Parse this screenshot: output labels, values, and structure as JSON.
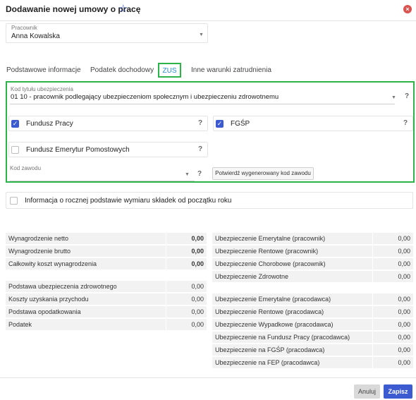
{
  "dialog": {
    "title": "Dodawanie nowej umowy o pracę",
    "cancel_label": "Anuluj",
    "save_label": "Zapisz"
  },
  "employee": {
    "label": "Pracownik",
    "value": "Anna Kowalska"
  },
  "tabs": [
    {
      "label": "Podstawowe informacje",
      "active": false
    },
    {
      "label": "Podatek dochodowy",
      "active": false
    },
    {
      "label": "ZUS",
      "active": true
    },
    {
      "label": "Inne warunki zatrudnienia",
      "active": false
    }
  ],
  "zus": {
    "insurance_code_label": "Kod tytułu ubezpieczenia",
    "insurance_code_value": "01 10 - pracownik podlegający ubezpieczeniom społecznym i ubezpieczeniu zdrowotnemu",
    "help": "?",
    "fundusz_pracy": {
      "label": "Fundusz Pracy",
      "checked": true
    },
    "fgsp": {
      "label": "FGŚP",
      "checked": true
    },
    "fep": {
      "label": "Fundusz Emerytur Pomostowych",
      "checked": false
    },
    "profession_code_label": "Kod zawodu",
    "profession_code_value": "",
    "confirm_code_label": "Potwierdź wygenerowany kod zawodu"
  },
  "annual_info": {
    "label": "Informacja o rocznej podstawie wymiaru składek od początku roku",
    "checked": false
  },
  "summary_left_top": [
    {
      "label": "Wynagrodzenie netto",
      "value": "0,00"
    },
    {
      "label": "Wynagrodzenie brutto",
      "value": "0,00"
    },
    {
      "label": "Całkowity koszt wynagrodzenia",
      "value": "0,00"
    }
  ],
  "summary_left_bottom": [
    {
      "label": "Podstawa ubezpieczenia zdrowotnego",
      "value": "0,00"
    },
    {
      "label": "Koszty uzyskania przychodu",
      "value": "0,00"
    },
    {
      "label": "Podstawa opodatkowania",
      "value": "0,00"
    },
    {
      "label": "Podatek",
      "value": "0,00"
    }
  ],
  "summary_right_top": [
    {
      "label": "Ubezpieczenie Emerytalne (pracownik)",
      "value": "0,00"
    },
    {
      "label": "Ubezpieczenie Rentowe (pracownik)",
      "value": "0,00"
    },
    {
      "label": "Ubezpieczenie Chorobowe (pracownik)",
      "value": "0,00"
    },
    {
      "label": "Ubezpieczenie Zdrowotne",
      "value": "0,00"
    }
  ],
  "summary_right_bottom": [
    {
      "label": "Ubezpieczenie Emerytalne (pracodawca)",
      "value": "0,00"
    },
    {
      "label": "Ubezpieczenie Rentowe (pracodawca)",
      "value": "0,00"
    },
    {
      "label": "Ubezpieczenie Wypadkowe (pracodawca)",
      "value": "0,00"
    },
    {
      "label": "Ubezpieczenie na Fundusz Pracy (pracodawca)",
      "value": "0,00"
    },
    {
      "label": "Ubezpieczenie na FGŚP (pracodawca)",
      "value": "0,00"
    },
    {
      "label": "Ubezpieczenie na FEP (pracodawca)",
      "value": "0,00"
    }
  ],
  "colors": {
    "accent": "#3c5bd0",
    "highlight": "#2cb34a",
    "danger": "#d9534f"
  }
}
